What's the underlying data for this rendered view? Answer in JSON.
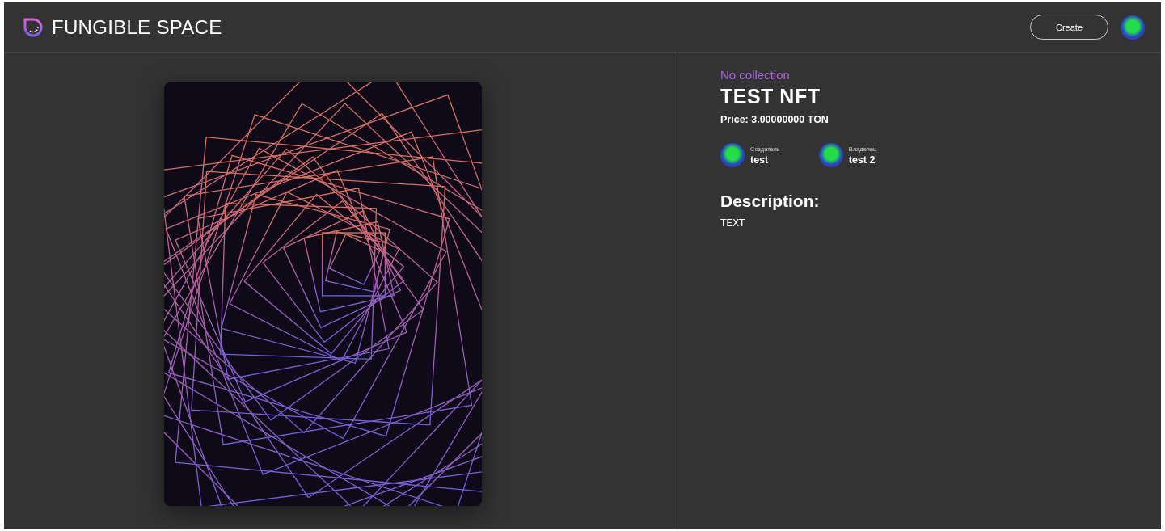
{
  "header": {
    "logo_text": "FUNGIBLE SPACE",
    "create_button": "Create"
  },
  "nft": {
    "collection": "No collection",
    "title": "TEST NFT",
    "price": "Price: 3.00000000 TON",
    "people": [
      {
        "role": "Создатель",
        "name": "test"
      },
      {
        "role": "Владелец",
        "name": "test 2"
      }
    ],
    "description_heading": "Description:",
    "description": "TEXT"
  }
}
